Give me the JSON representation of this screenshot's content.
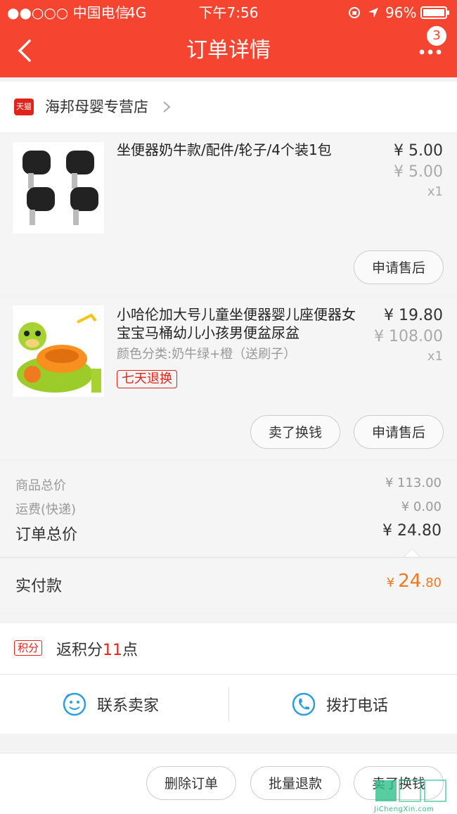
{
  "status_bar": {
    "carrier": "●●○○○ 中国电信",
    "network": "4G",
    "time": "下午7:56",
    "battery": "96%"
  },
  "header": {
    "title": "订单详情",
    "badge_count": "3"
  },
  "store": {
    "logo_text": "天猫",
    "name": "海邦母婴专营店"
  },
  "items": [
    {
      "name": "坐便器奶牛款/配件/轮子/4个装1包",
      "price": "¥ 5.00",
      "original_price": "¥ 5.00",
      "qty": "x1",
      "sku": "",
      "buttons": [
        "申请售后"
      ]
    },
    {
      "name": "小哈伦加大号儿童坐便器婴儿座便器女宝宝马桶幼儿小孩男便盆尿盆",
      "price": "¥ 19.80",
      "original_price": "¥ 108.00",
      "qty": "x1",
      "sku": "颜色分类:奶牛绿+橙（送刷子）",
      "tag": "七天退换",
      "buttons": [
        "卖了换钱",
        "申请售后"
      ]
    }
  ],
  "summary": {
    "goods_total_label": "商品总价",
    "goods_total": "¥ 113.00",
    "shipping_label": "运费(快递)",
    "shipping": "¥ 0.00",
    "order_total_label": "订单总价",
    "order_total": "¥ 24.80",
    "paid_label": "实付款",
    "paid_currency": "¥",
    "paid_int": "24",
    "paid_dec": ".80"
  },
  "points": {
    "tag": "积分",
    "text_before": "返积分",
    "value": "11",
    "text_after": "点"
  },
  "contact": {
    "seller": "联系卖家",
    "call": "拨打电话"
  },
  "bottom_actions": [
    "删除订单",
    "批量退款",
    "卖了换钱"
  ],
  "watermark": {
    "text": "JiChengXin.com"
  },
  "colors": {
    "brand": "#f5442f",
    "accent_orange": "#f07820",
    "tmall_red": "#e2231a"
  }
}
